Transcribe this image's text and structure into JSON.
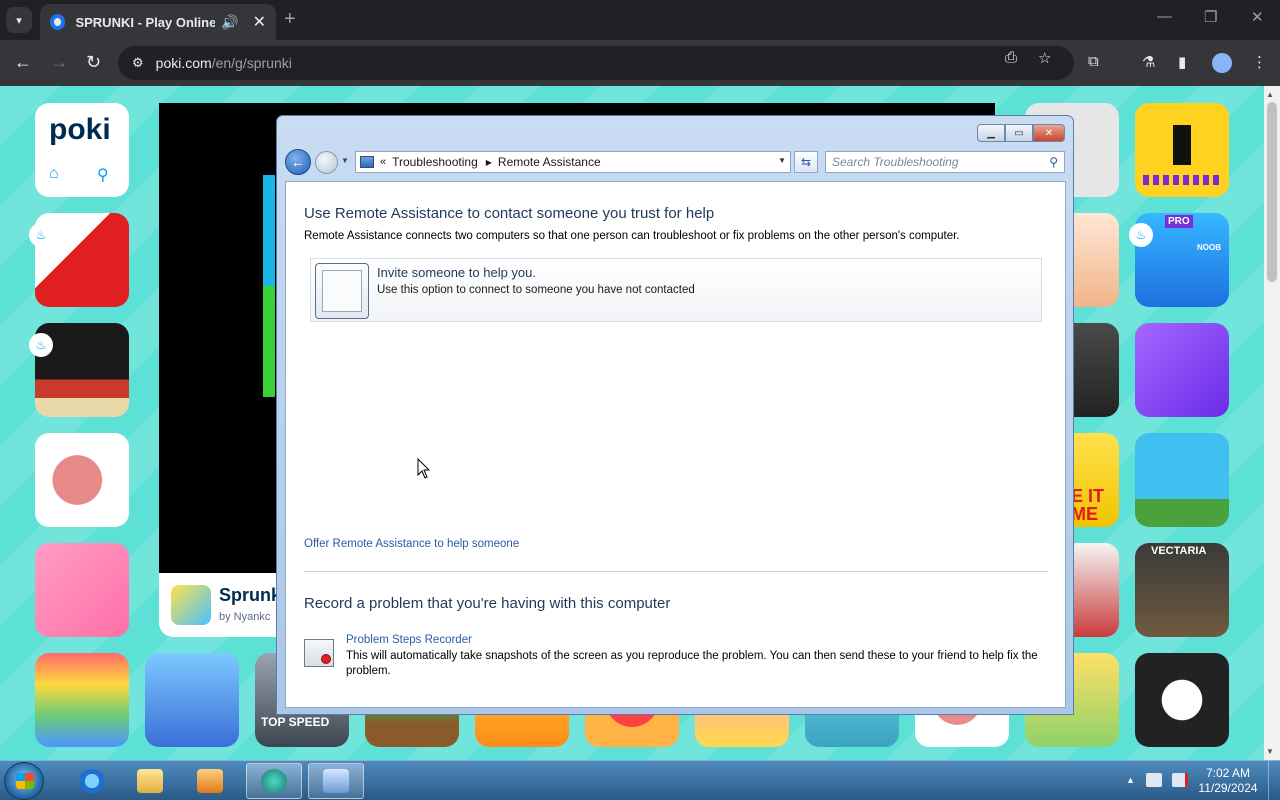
{
  "browser": {
    "tab_title": "SPRUNKI - Play Online for",
    "url_host": "poki.com",
    "url_path": "/en/g/sprunki"
  },
  "poki": {
    "logo": "poki",
    "game_name": "Sprunki",
    "game_by": "by Nyankc",
    "tile_label_top_speed": "TOP SPEED",
    "tile_label_pro": "PRO",
    "tile_label_noob": "NOOB",
    "tile_label_vectaria": "VECTARIA",
    "tile_label_meit": "E IT ME"
  },
  "window": {
    "address": {
      "chevron": "«",
      "segments": [
        "Troubleshooting",
        "Remote Assistance"
      ]
    },
    "search_placeholder": "Search Troubleshooting",
    "heading": "Use Remote Assistance to contact someone you trust for help",
    "description": "Remote Assistance connects two computers so that one person can troubleshoot or fix problems on the other person's computer.",
    "invite_title": "Invite someone to help you.",
    "invite_sub": "Use this option to connect to someone you have not contacted",
    "offer_link": "Offer Remote Assistance to help someone",
    "record_heading": "Record a problem that you're having with this computer",
    "psr_title": "Problem Steps Recorder",
    "psr_desc": "This will automatically take snapshots of the screen as you reproduce the problem. You can then send these to your friend to help fix the problem."
  },
  "taskbar": {
    "time": "7:02 AM",
    "date": "11/29/2024"
  },
  "colors": {
    "poki_bg": "#5de0d6",
    "chrome_dark": "#202124",
    "win7_link": "#2b59a8",
    "win7_heading": "#1e395b"
  }
}
